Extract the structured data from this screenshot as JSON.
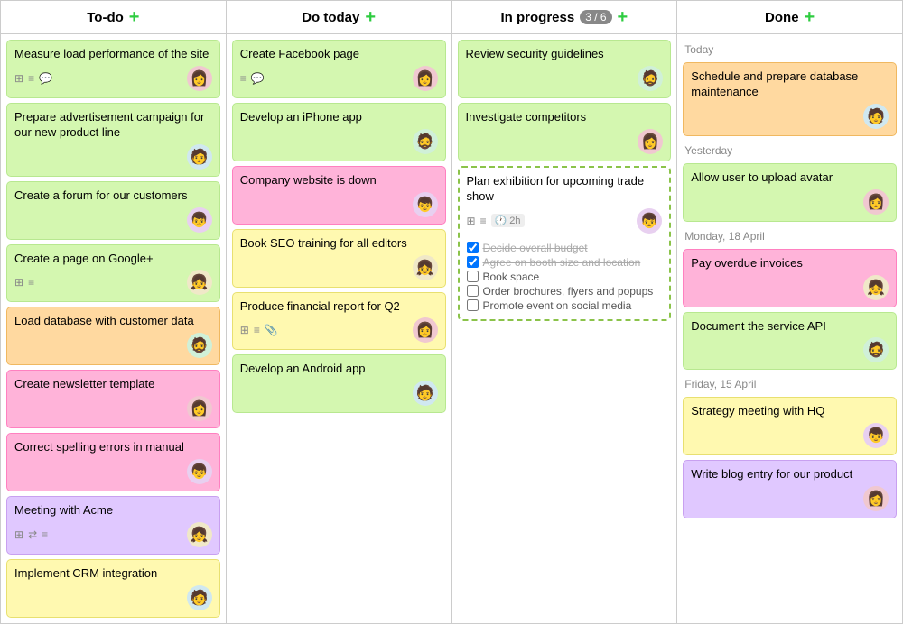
{
  "columns": [
    {
      "id": "todo",
      "title": "To-do",
      "badge": null,
      "cards": [
        {
          "id": "c1",
          "title": "Measure load performance of the site",
          "color": "green",
          "icons": [
            "grid",
            "list",
            "chat"
          ],
          "avatar": "👩",
          "avatar_bg": "#f0c8d0"
        },
        {
          "id": "c2",
          "title": "Prepare advertisement campaign for our new product line",
          "color": "green",
          "icons": [],
          "avatar": "🧑",
          "avatar_bg": "#d0e8f0"
        },
        {
          "id": "c3",
          "title": "Create a forum for our customers",
          "color": "green",
          "icons": [],
          "avatar": "👦",
          "avatar_bg": "#e8d0f0"
        },
        {
          "id": "c4",
          "title": "Create a page on Google+",
          "color": "green",
          "icons": [
            "grid",
            "list"
          ],
          "avatar": "👧",
          "avatar_bg": "#f0e8c8"
        },
        {
          "id": "c5",
          "title": "Load database with customer data",
          "color": "orange",
          "icons": [],
          "avatar": "🧔",
          "avatar_bg": "#d0f0d8"
        },
        {
          "id": "c6",
          "title": "Create newsletter template",
          "color": "pink",
          "icons": [],
          "avatar": "👩",
          "avatar_bg": "#f0c8d0"
        },
        {
          "id": "c7",
          "title": "Correct spelling errors in manual",
          "color": "pink",
          "icons": [],
          "avatar": "👦",
          "avatar_bg": "#e8d0f0"
        },
        {
          "id": "c8",
          "title": "Meeting with Acme",
          "color": "purple",
          "icons": [
            "grid",
            "repeat",
            "list"
          ],
          "avatar": "👧",
          "avatar_bg": "#f0e8c8"
        },
        {
          "id": "c9",
          "title": "Implement CRM integration",
          "color": "yellow",
          "icons": [],
          "avatar": "🧑",
          "avatar_bg": "#d0e8f0"
        }
      ]
    },
    {
      "id": "dotoday",
      "title": "Do today",
      "badge": null,
      "cards": [
        {
          "id": "d1",
          "title": "Create Facebook page",
          "color": "green",
          "icons": [
            "list",
            "chat"
          ],
          "avatar": "👩",
          "avatar_bg": "#f0c8d0"
        },
        {
          "id": "d2",
          "title": "Develop an iPhone app",
          "color": "green",
          "icons": [],
          "avatar": "🧔",
          "avatar_bg": "#d0f0d8"
        },
        {
          "id": "d3",
          "title": "Company website is down",
          "color": "pink",
          "icons": [],
          "avatar": "👦",
          "avatar_bg": "#e8d0f0"
        },
        {
          "id": "d4",
          "title": "Book SEO training for all editors",
          "color": "yellow",
          "icons": [],
          "avatar": "👧",
          "avatar_bg": "#f0e8c8"
        },
        {
          "id": "d5",
          "title": "Produce financial report for Q2",
          "color": "yellow",
          "icons": [
            "grid",
            "list",
            "clip"
          ],
          "avatar": "👩",
          "avatar_bg": "#f0c8d0"
        },
        {
          "id": "d6",
          "title": "Develop an Android app",
          "color": "green",
          "icons": [],
          "avatar": "🧑",
          "avatar_bg": "#d0e8f0"
        }
      ]
    },
    {
      "id": "inprogress",
      "title": "In progress",
      "badge": "3 / 6",
      "cards": [
        {
          "id": "p1",
          "title": "Review security guidelines",
          "color": "green",
          "icons": [],
          "avatar": "🧔",
          "avatar_bg": "#d0f0d8",
          "expanded": false,
          "checklist": []
        },
        {
          "id": "p2",
          "title": "Investigate competitors",
          "color": "green",
          "icons": [],
          "avatar": "👩",
          "avatar_bg": "#f0c8d0",
          "expanded": false,
          "checklist": []
        },
        {
          "id": "p3",
          "title": "Plan exhibition for upcoming trade show",
          "color": "expanded",
          "icons": [
            "grid",
            "list",
            "clock"
          ],
          "time": "2h",
          "avatar": "👦",
          "avatar_bg": "#e8d0f0",
          "expanded": true,
          "checklist": [
            {
              "text": "Decide overall budget",
              "checked": true
            },
            {
              "text": "Agree on booth size and location",
              "checked": true
            },
            {
              "text": "Book space",
              "checked": false
            },
            {
              "text": "Order brochures, flyers and popups",
              "checked": false
            },
            {
              "text": "Promote event on social media",
              "checked": false
            }
          ]
        }
      ]
    },
    {
      "id": "done",
      "title": "Done",
      "badge": null,
      "sections": [
        {
          "label": "Today",
          "cards": [
            {
              "id": "dn1",
              "title": "Schedule and prepare database maintenance",
              "color": "orange",
              "avatar": "🧑",
              "avatar_bg": "#d0e8f0"
            }
          ]
        },
        {
          "label": "Yesterday",
          "cards": [
            {
              "id": "dn2",
              "title": "Allow user to upload avatar",
              "color": "green",
              "avatar": "👩",
              "avatar_bg": "#f0c8d0"
            }
          ]
        },
        {
          "label": "Monday, 18 April",
          "cards": [
            {
              "id": "dn3",
              "title": "Pay overdue invoices",
              "color": "pink",
              "avatar": "👧",
              "avatar_bg": "#f0e8c8"
            },
            {
              "id": "dn4",
              "title": "Document the service API",
              "color": "green",
              "avatar": "🧔",
              "avatar_bg": "#d0f0d8"
            }
          ]
        },
        {
          "label": "Friday, 15 April",
          "cards": [
            {
              "id": "dn5",
              "title": "Strategy meeting with HQ",
              "color": "yellow",
              "avatar": "👦",
              "avatar_bg": "#e8d0f0"
            },
            {
              "id": "dn6",
              "title": "Write blog entry for our product",
              "color": "purple",
              "avatar": "👩",
              "avatar_bg": "#f0c8d0"
            }
          ]
        }
      ]
    }
  ],
  "icons": {
    "add": "+",
    "grid": "⊞",
    "list": "≡",
    "chat": "💬",
    "repeat": "⇄",
    "clip": "📎",
    "clock": "🕐"
  }
}
